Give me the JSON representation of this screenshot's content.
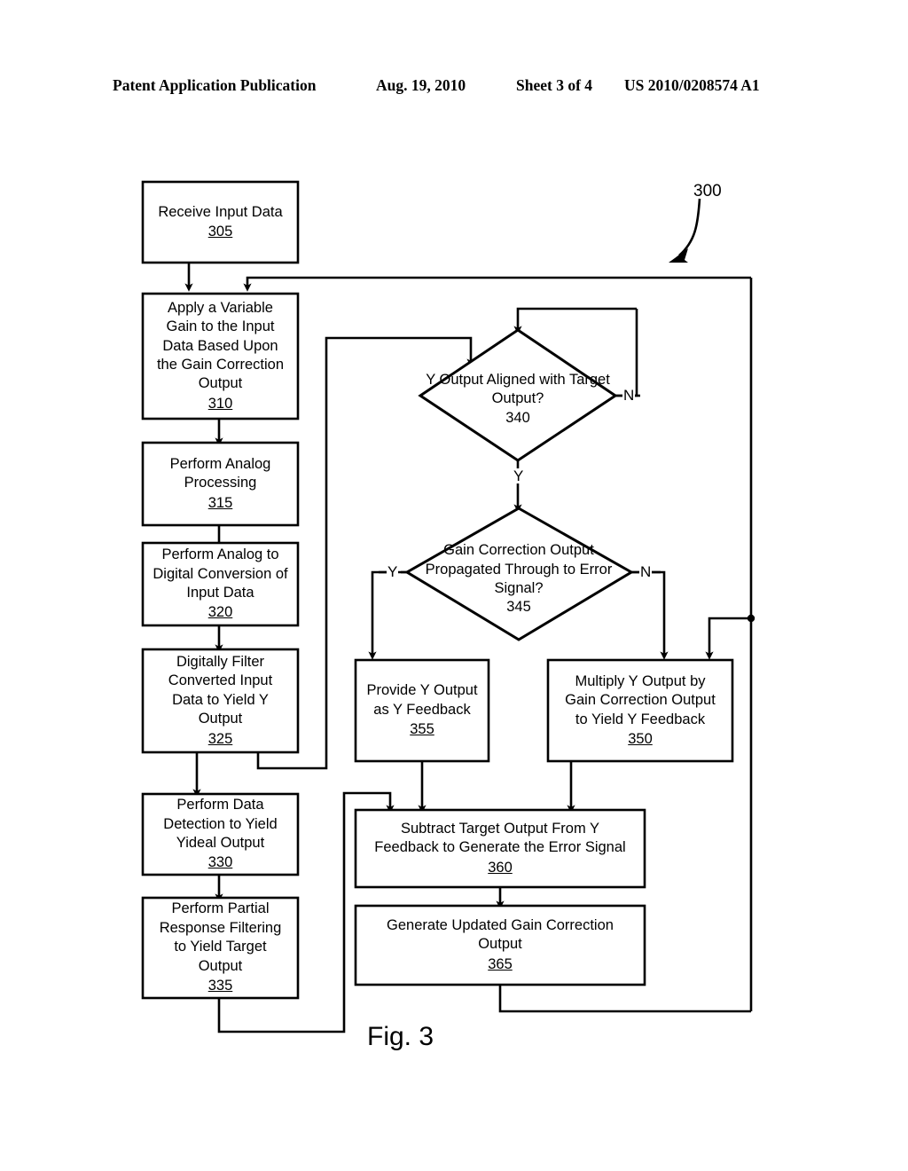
{
  "header": {
    "publication": "Patent Application Publication",
    "date": "Aug. 19, 2010",
    "sheet": "Sheet 3 of 4",
    "patent_number": "US 2010/0208574 A1"
  },
  "figure": {
    "caption": "Fig. 3",
    "diagram_reference": "300"
  },
  "nodes": {
    "n305": {
      "text": "Receive Input Data",
      "ref": "305",
      "shape": "process"
    },
    "n310": {
      "text": "Apply a Variable\nGain to the Input\nData Based Upon\nthe Gain Correction\nOutput",
      "ref": "310",
      "shape": "process"
    },
    "n315": {
      "text": "Perform Analog\nProcessing",
      "ref": "315",
      "shape": "process"
    },
    "n320": {
      "text": "Perform Analog to\nDigital Conversion of\nInput Data",
      "ref": "320",
      "shape": "process"
    },
    "n325": {
      "text": "Digitally Filter\nConverted Input\nData to Yield Y\nOutput",
      "ref": "325",
      "shape": "process"
    },
    "n330": {
      "text": "Perform Data\nDetection to Yield\nYideal Output",
      "ref": "330",
      "shape": "process"
    },
    "n335": {
      "text": "Perform Partial\nResponse Filtering\nto Yield Target\nOutput",
      "ref": "335",
      "shape": "process"
    },
    "n340": {
      "text": "Y Output\nAligned with Target\nOutput?",
      "ref": "340",
      "shape": "decision"
    },
    "n345": {
      "text": "Gain\nCorrection Output\nPropagated Through to\nError Signal?",
      "ref": "345",
      "shape": "decision"
    },
    "n350": {
      "text": "Multiply Y Output by\nGain Correction Output\nto Yield Y Feedback",
      "ref": "350",
      "shape": "process"
    },
    "n355": {
      "text": "Provide Y Output\nas Y Feedback",
      "ref": "355",
      "shape": "process"
    },
    "n360": {
      "text": "Subtract Target Output From Y\nFeedback to Generate the Error Signal",
      "ref": "360",
      "shape": "process"
    },
    "n365": {
      "text": "Generate Updated Gain Correction\nOutput",
      "ref": "365",
      "shape": "process"
    }
  },
  "branches": {
    "d340_no": "N",
    "d340_yes": "Y",
    "d345_yes": "Y",
    "d345_no": "N"
  },
  "colors": {
    "stroke": "#000000",
    "background": "#ffffff"
  }
}
